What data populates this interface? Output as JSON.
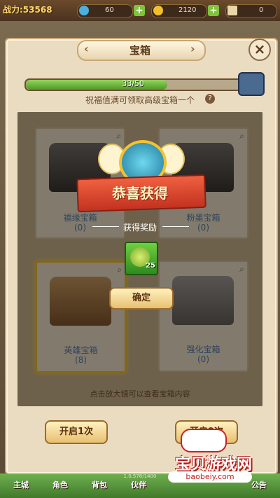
{
  "topbar": {
    "power_label": "战力:53568",
    "gem_amount": "60",
    "gold_amount": "2120",
    "ticket_amount": "0"
  },
  "dialog": {
    "title": "宝箱",
    "progress_text": "33/50",
    "progress_value": 0.66,
    "bless_text": "祝福值满可领取高级宝箱一个"
  },
  "chests": [
    {
      "name": "福缘宝箱",
      "count": "(0)"
    },
    {
      "name": "粉墨宝箱",
      "count": "(0)"
    },
    {
      "name": "英雄宝箱",
      "count": "(8)"
    },
    {
      "name": "强化宝箱",
      "count": "(0)"
    }
  ],
  "hint": "点击放大镜可以查看宝箱内容",
  "reward": {
    "banner": "恭喜获得",
    "label": "获得奖励",
    "item_count": "25",
    "confirm": "确定"
  },
  "buttons": {
    "open1": "开启1次",
    "open9": "开启9次"
  },
  "nav": [
    "主城",
    "角色",
    "背包",
    "伙伴",
    "公告"
  ],
  "version": "1.0.578/1400",
  "watermark": {
    "text": "宝贝游戏网",
    "url": "baobeiy.com"
  },
  "colors": {
    "accent_gold": "#f1c12a",
    "banner_red": "#d64028",
    "progress_green": "#6cb83a"
  }
}
